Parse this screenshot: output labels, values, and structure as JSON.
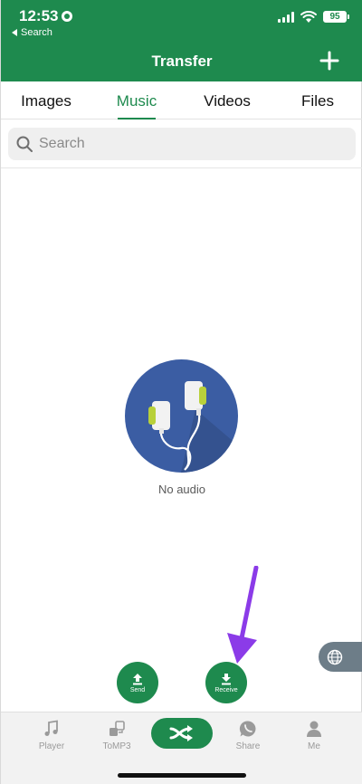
{
  "status": {
    "time": "12:53",
    "back_label": "Search",
    "battery": "95"
  },
  "header": {
    "title": "Transfer",
    "add_icon": "plus-icon"
  },
  "tabs": [
    {
      "label": "Images",
      "active": false
    },
    {
      "label": "Music",
      "active": true
    },
    {
      "label": "Videos",
      "active": false
    },
    {
      "label": "Files",
      "active": false
    }
  ],
  "search": {
    "placeholder": "Search",
    "icon": "search-icon"
  },
  "empty_state": {
    "text": "No audio",
    "icon": "earphones-icon"
  },
  "actions": {
    "send_label": "Send",
    "receive_label": "Receive"
  },
  "bottom_nav": {
    "items": [
      {
        "label": "Player",
        "icon": "music-note-icon"
      },
      {
        "label": "ToMP3",
        "icon": "convert-icon"
      },
      {
        "label": "",
        "icon": "shuffle-transfer-icon"
      },
      {
        "label": "Share",
        "icon": "whatsapp-icon"
      },
      {
        "label": "Me",
        "icon": "person-icon"
      }
    ]
  },
  "colors": {
    "primary": "#1e8a4e",
    "illustration_bg": "#3b5da3",
    "earbud_accent": "#b8d03a",
    "annotation_arrow": "#8b3be8"
  }
}
